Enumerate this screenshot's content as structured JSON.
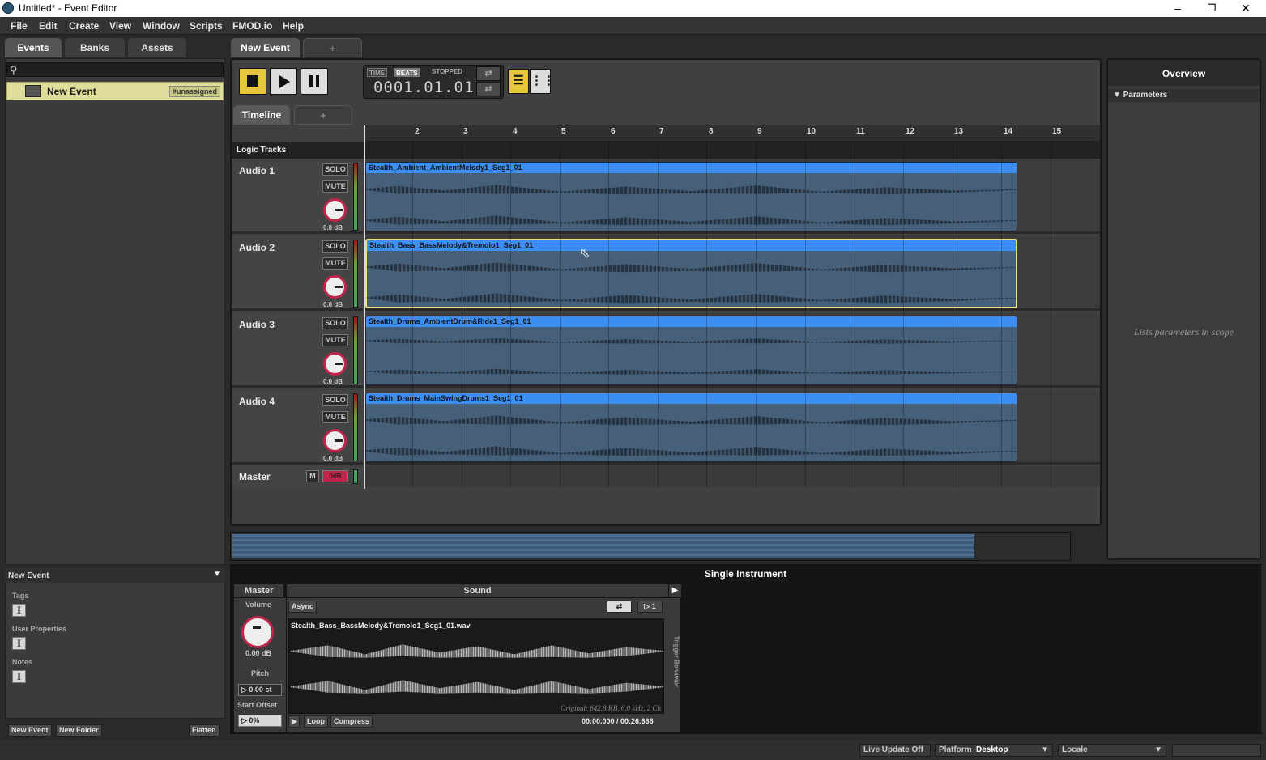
{
  "window": {
    "title": "Untitled* - Event Editor"
  },
  "menu": [
    "File",
    "Edit",
    "Create",
    "View",
    "Window",
    "Scripts",
    "FMOD.io",
    "Help"
  ],
  "browser": {
    "tabs": [
      "Events",
      "Banks",
      "Assets"
    ],
    "search_placeholder": "",
    "events": [
      {
        "label": "New Event",
        "badge": "#unassigned"
      }
    ]
  },
  "properties": {
    "header": "New Event",
    "tags_label": "Tags",
    "user_properties_label": "User Properties",
    "notes_label": "Notes",
    "buttons": {
      "new_event": "New Event",
      "new_folder": "New Folder",
      "flatten": "Flatten"
    }
  },
  "editor": {
    "tabs": [
      "New Event",
      "+"
    ],
    "transport": {
      "time_mode": "TIME",
      "beats_mode": "BEATS",
      "state": "STOPPED",
      "position": "0001.01.01"
    },
    "sub_tabs": [
      "Timeline",
      "+"
    ],
    "ruler": [
      "2",
      "3",
      "4",
      "5",
      "6",
      "7",
      "8",
      "9",
      "10",
      "11",
      "12",
      "13",
      "14",
      "15"
    ],
    "logic_tracks_label": "Logic Tracks",
    "solo_label": "SOLO",
    "mute_label": "MUTE",
    "tracks": [
      {
        "name": "Audio 1",
        "db": "0.0 dB",
        "region": "Stealth_Ambient_AmbientMelody1_Seg1_01"
      },
      {
        "name": "Audio 2",
        "db": "0.0 dB",
        "region": "Stealth_Bass_BassMelody&Tremolo1_Seg1_01"
      },
      {
        "name": "Audio 3",
        "db": "0.0 dB",
        "region": "Stealth_Drums_AmbientDrum&Ride1_Seg1_01"
      },
      {
        "name": "Audio 4",
        "db": "0.0 dB",
        "region": "Stealth_Drums_MainSwingDrums1_Seg1_01"
      }
    ],
    "master": {
      "name": "Master",
      "m_label": "M",
      "fader_label": "0dB"
    }
  },
  "overview": {
    "title": "Overview",
    "parameters_label": "Parameters",
    "empty_text": "Lists parameters in scope"
  },
  "deck": {
    "title": "Single Instrument",
    "master_label": "Master",
    "sound_label": "Sound",
    "volume_label": "Volume",
    "volume_value": "0.00 dB",
    "pitch_label": "Pitch",
    "pitch_value": "0.00 st",
    "start_offset_label": "Start Offset",
    "start_offset_value": "0%",
    "async_label": "Async",
    "play_count": "1",
    "trigger_behavior_label": "Trigger Behavior",
    "file_name": "Stealth_Bass_BassMelody&Tremolo1_Seg1_01.wav",
    "file_info": "Original: 642.8 KB, 6.0 kHz, 2 Ch",
    "time": "00:00.000 / 00:26.666",
    "loop_label": "Loop",
    "compress_label": "Compress"
  },
  "status": {
    "live_update": "Live Update Off",
    "platform_label": "Platform",
    "platform_value": "Desktop",
    "locale_label": "Locale",
    "locale_value": ""
  },
  "colors": {
    "accent_yellow": "#e6c63a",
    "region_header": "#3c8ff0",
    "knob_ring": "#c0264a",
    "selection": "#e6e17a"
  }
}
